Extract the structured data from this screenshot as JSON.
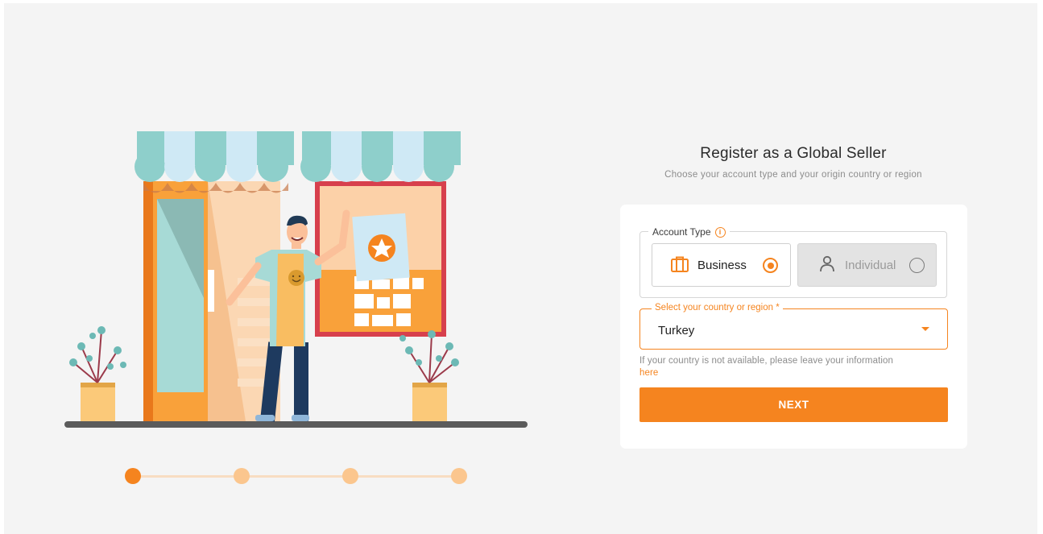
{
  "header": {
    "title": "Register as a Global Seller",
    "subtitle": "Choose your account type and your origin country or region"
  },
  "account_type": {
    "legend": "Account Type",
    "info_icon": "info-icon",
    "options": [
      {
        "label": "Business",
        "icon": "briefcase-icon",
        "selected": true
      },
      {
        "label": "Individual",
        "icon": "user-icon",
        "selected": false
      }
    ]
  },
  "country": {
    "label": "Select your country or region *",
    "value": "Turkey"
  },
  "note": {
    "text": "If your country is not available, please leave your information",
    "link": "here"
  },
  "next_label": "NEXT",
  "stepper": {
    "steps": 4,
    "current": 1
  },
  "colors": {
    "accent": "#f5841f",
    "background": "#f4f4f4",
    "card": "#ffffff"
  }
}
